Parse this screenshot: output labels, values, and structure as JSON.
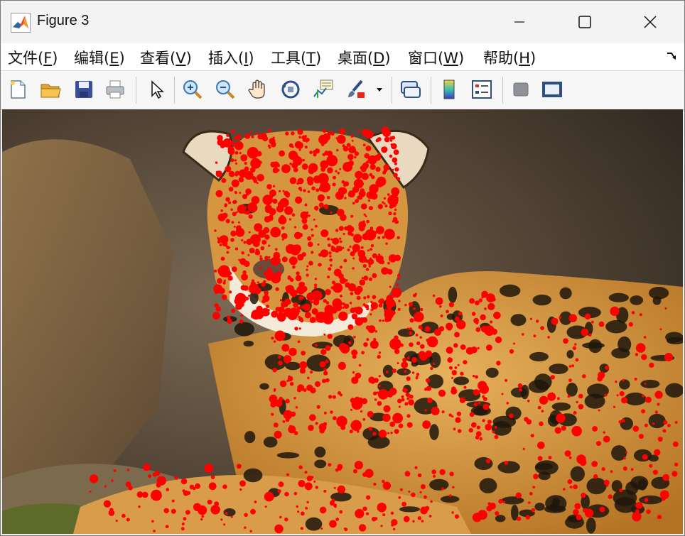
{
  "window": {
    "title": "Figure 3",
    "accent": "#e4502a"
  },
  "menubar": {
    "items": [
      {
        "label": "文件(",
        "acc": "F",
        "tail": ")"
      },
      {
        "label": "编辑(",
        "acc": "E",
        "tail": ")"
      },
      {
        "label": "查看(",
        "acc": "V",
        "tail": ")"
      },
      {
        "label": "插入(",
        "acc": "I",
        "tail": ")"
      },
      {
        "label": "工具(",
        "acc": "T",
        "tail": ")"
      },
      {
        "label": "桌面(",
        "acc": "D",
        "tail": ")"
      },
      {
        "label": "窗口(",
        "acc": "W",
        "tail": ")"
      },
      {
        "label": "帮助(",
        "acc": "H",
        "tail": ")"
      }
    ]
  },
  "toolbar": {
    "icons": [
      "new-figure-icon",
      "open-folder-icon",
      "save-icon",
      "print-icon",
      "pointer-icon",
      "zoom-in-icon",
      "zoom-out-icon",
      "pan-hand-icon",
      "rotate-3d-icon",
      "data-cursor-icon",
      "brush-icon",
      "link-plot-icon",
      "colorbar-icon",
      "legend-icon",
      "hide-plot-tools-icon",
      "show-plot-tools-icon"
    ]
  },
  "figure": {
    "marker_color": "#ff0000",
    "description_colors": {
      "background": "#5b4a35",
      "fur": "#c98a3a"
    }
  }
}
